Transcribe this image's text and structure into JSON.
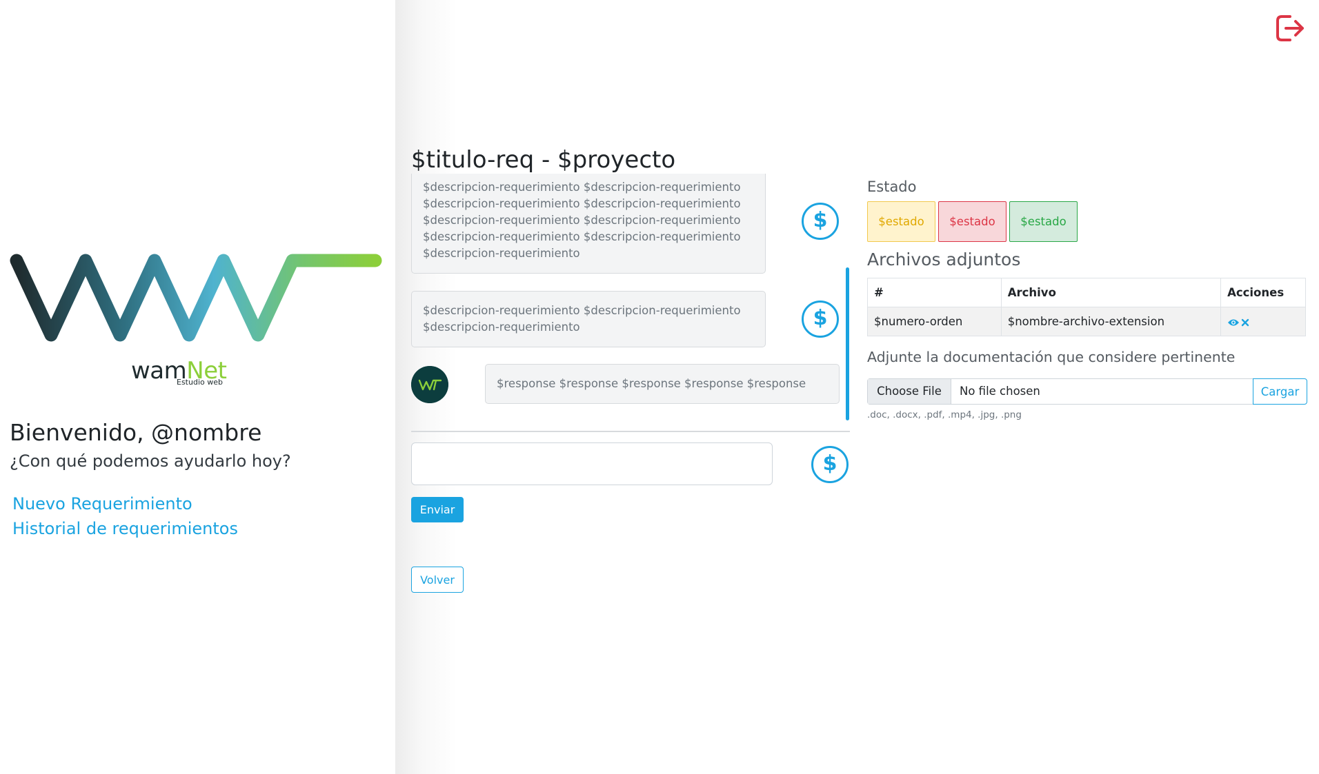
{
  "sidebar": {
    "brand_main": "wam",
    "brand_accent": "Net",
    "brand_tagline": "Estudio web",
    "welcome_title": "Bienvenido, @nombre",
    "welcome_subtitle": "¿Con qué podemos ayudarlo hoy?",
    "links": [
      {
        "label": "Nuevo Requerimiento"
      },
      {
        "label": "Historial de requerimientos"
      }
    ]
  },
  "header": {
    "logout_icon": "logout-icon"
  },
  "main": {
    "title": "$titulo-req - $proyecto",
    "messages": [
      {
        "text": "$descripcion-requerimiento $descripcion-requerimiento $descripcion-requerimiento $descripcion-requerimiento $descripcion-requerimiento $descripcion-requerimiento $descripcion-requerimiento $descripcion-requerimiento $descripcion-requerimiento"
      },
      {
        "text": "$descripcion-requerimiento $descripcion-requerimiento $descripcion-requerimiento"
      }
    ],
    "response": {
      "text": "$response $response $response $response $response"
    },
    "dollar_symbol": "$",
    "send_label": "Enviar",
    "back_label": "Volver"
  },
  "right": {
    "estado_label": "Estado",
    "badges": [
      {
        "label": "$estado",
        "color": "#e0a800"
      },
      {
        "label": "$estado",
        "color": "#dc3545"
      },
      {
        "label": "$estado",
        "color": "#28a745"
      }
    ],
    "archivos_label": "Archivos adjuntos",
    "table": {
      "headers": [
        "#",
        "Archivo",
        "Acciones"
      ],
      "rows": [
        {
          "numero": "$numero-orden",
          "archivo": "$nombre-archivo-extension"
        }
      ]
    },
    "adjunte_label": "Adjunte la documentación que considere pertinente",
    "choose_file_label": "Choose File",
    "no_file_label": "No file chosen",
    "cargar_label": "Cargar",
    "file_hint": ".doc, .docx, .pdf, .mp4, .jpg, .png"
  },
  "colors": {
    "accent": "#1aa3e0",
    "logout": "#dc3545",
    "brand_green": "#8ccf3a"
  }
}
